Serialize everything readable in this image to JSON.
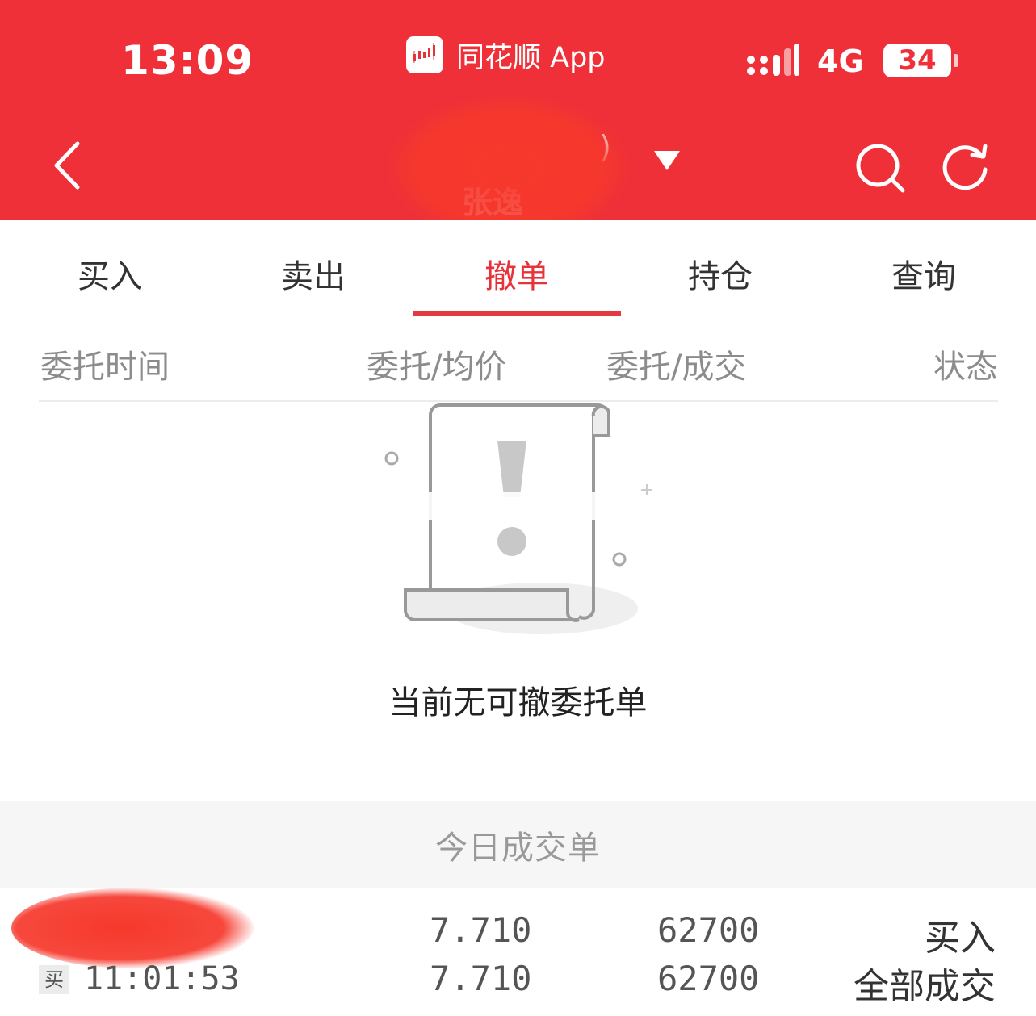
{
  "status_bar": {
    "time": "13:09",
    "app_name": "同花顺 App",
    "network": "4G",
    "battery": "34"
  },
  "nav": {
    "account_suffix": ")",
    "account_name": "张逸"
  },
  "tabs": [
    {
      "label": "买入",
      "active": false
    },
    {
      "label": "卖出",
      "active": false
    },
    {
      "label": "撤单",
      "active": true
    },
    {
      "label": "持仓",
      "active": false
    },
    {
      "label": "查询",
      "active": false
    }
  ],
  "columns": {
    "time": "委托时间",
    "price": "委托/均价",
    "qty": "委托/成交",
    "status": "状态"
  },
  "empty_state": {
    "message": "当前无可撤委托单"
  },
  "today_deals": {
    "title": "今日成交单",
    "rows": [
      {
        "name": "",
        "side": "买",
        "time": "11:01:53",
        "order_price": "7.710",
        "avg_price": "7.710",
        "order_qty": "62700",
        "filled_qty": "62700",
        "direction": "买入",
        "status": "全部成交"
      }
    ]
  },
  "colors": {
    "brand_red": "#ef3038",
    "active_tab": "#e8323a"
  },
  "icons": [
    "app-logo-icon",
    "signal-icon",
    "back-icon",
    "dropdown-icon",
    "search-icon",
    "refresh-icon",
    "empty-document-icon"
  ]
}
